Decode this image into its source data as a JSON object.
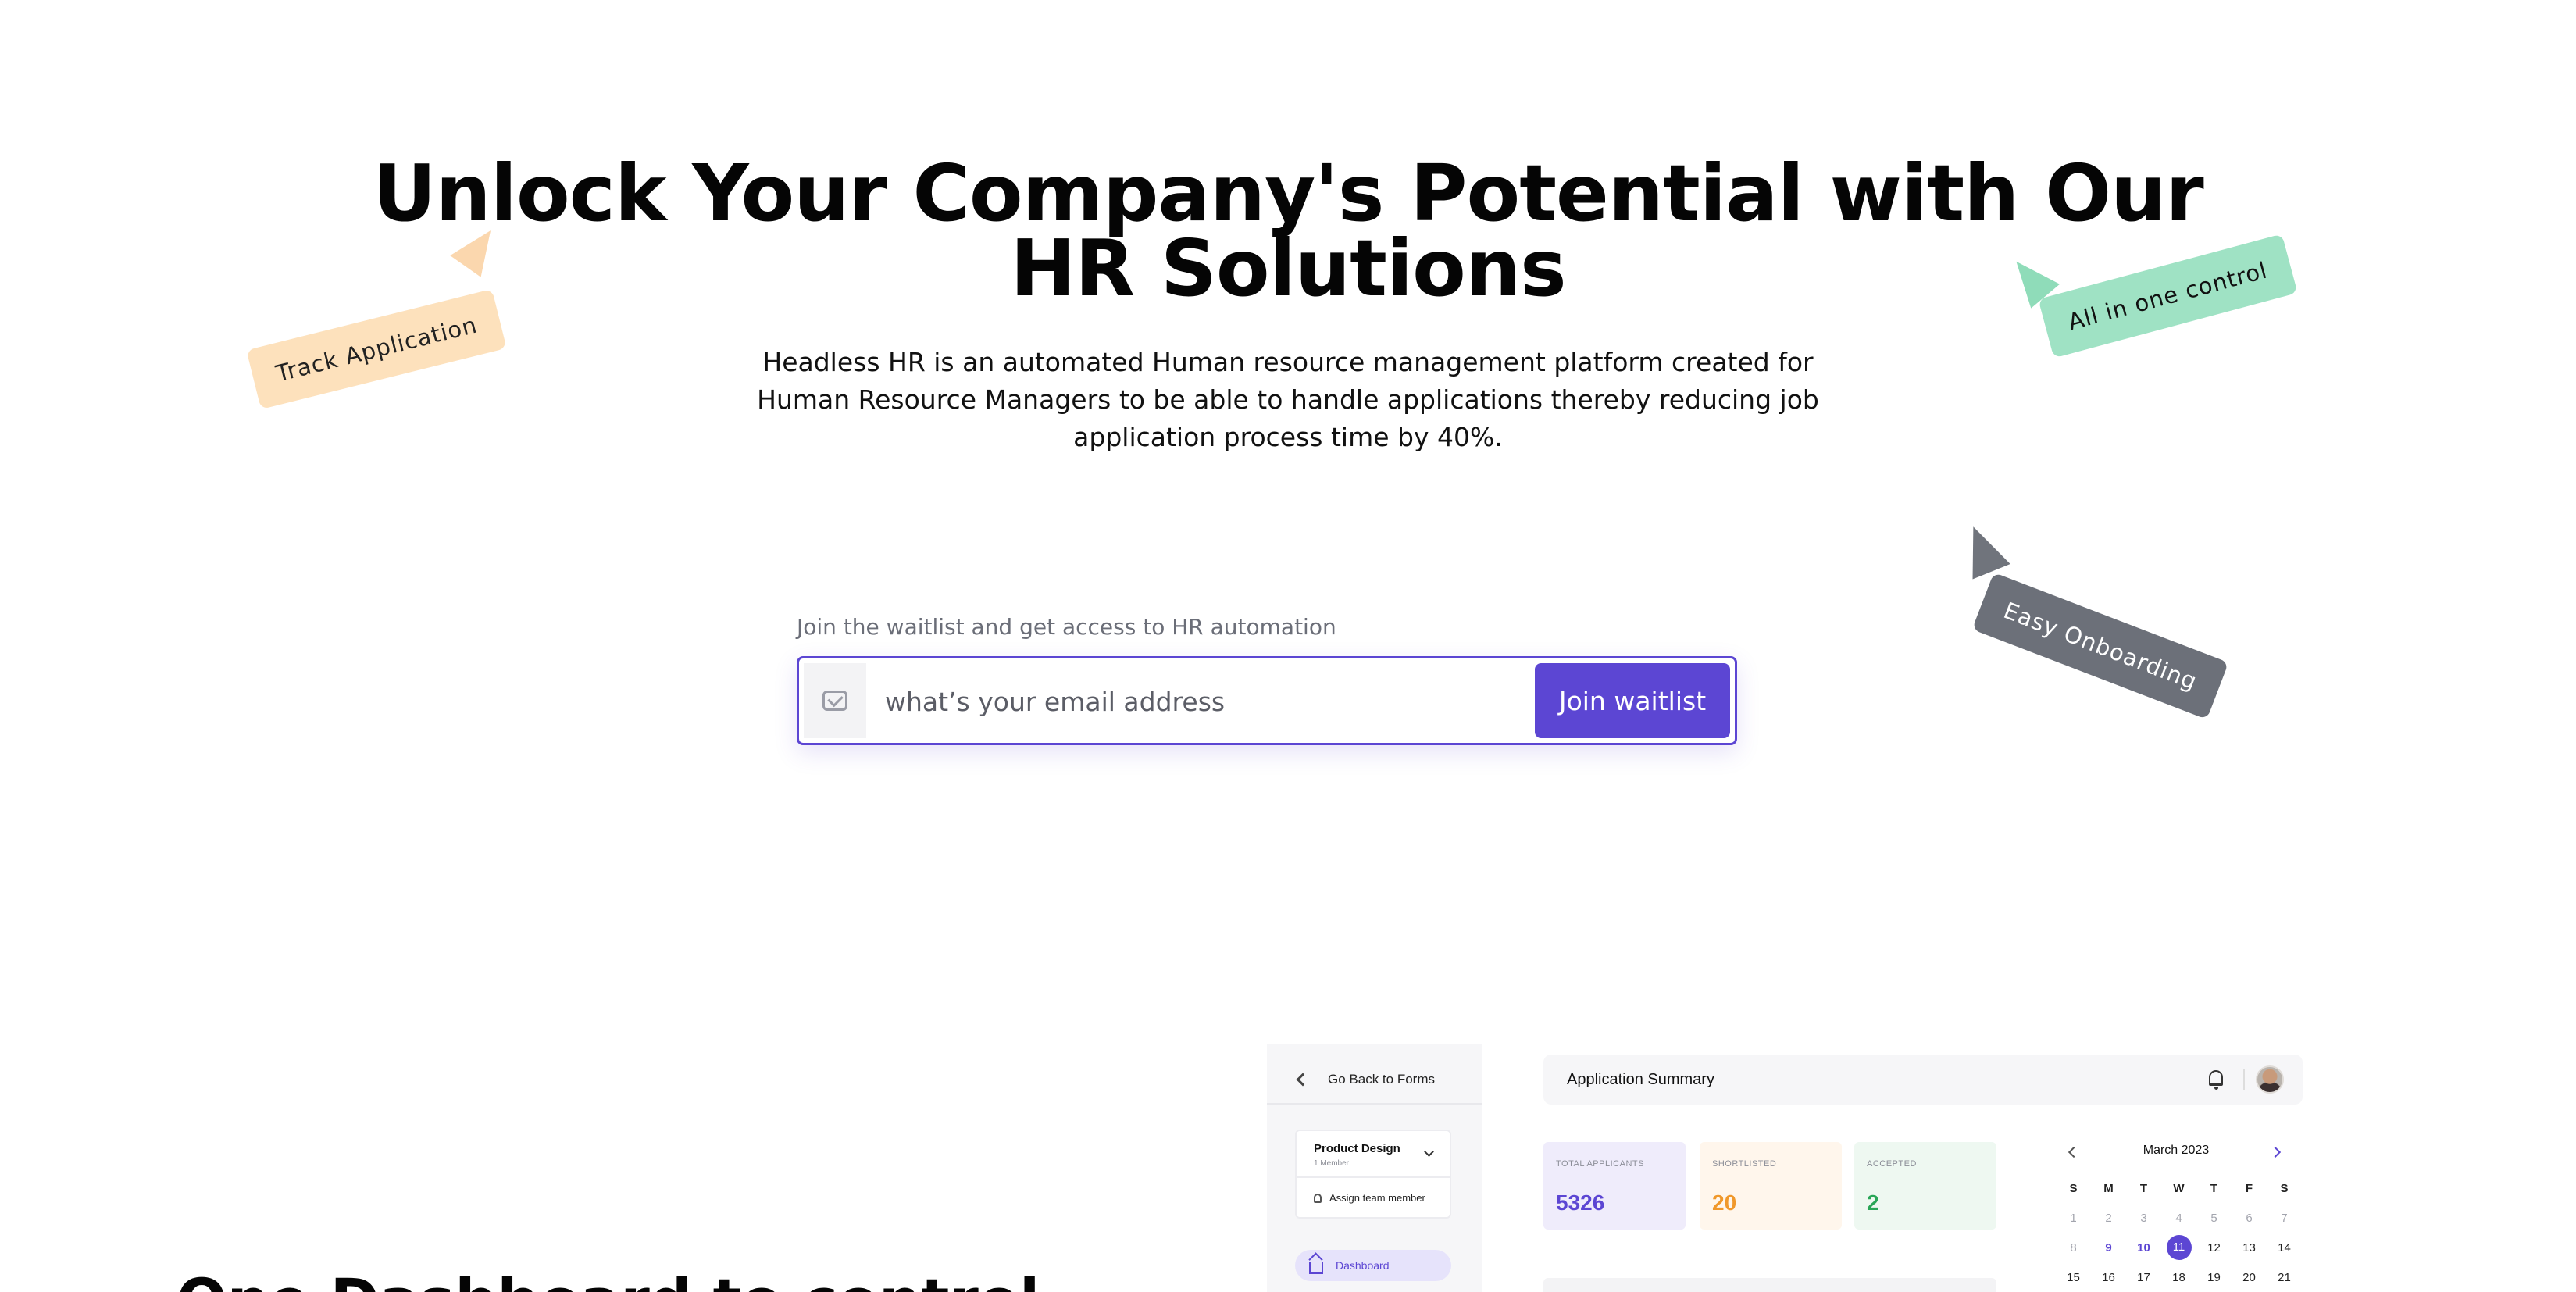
{
  "hero": {
    "title_line1": "Unlock Your Company's Potential with Our",
    "title_line2": "HR Solutions",
    "subtitle": "Headless HR is an automated Human resource management platform created for Human Resource Managers to be able to handle applications thereby reducing job application process time by 40%."
  },
  "tags": {
    "track": "Track Application",
    "control": "All in one control",
    "onboarding": "Easy Onboarding"
  },
  "waitlist": {
    "label": "Join the waitlist and get access to HR automation",
    "email_placeholder": "what’s your email address",
    "email_value": "",
    "button_label": "Join waitlist"
  },
  "section": {
    "heading": "One Dashboard to control"
  },
  "dashboard": {
    "back_label": "Go Back to Forms",
    "team_name": "Product Design",
    "team_members": "1 Member",
    "assign_label": "Assign team member",
    "nav_dashboard": "Dashboard",
    "summary_title": "Application Summary",
    "stats": [
      {
        "label": "TOTAL APPLICANTS",
        "value": "5326"
      },
      {
        "label": "SHORTLISTED",
        "value": "20"
      },
      {
        "label": "ACCEPTED",
        "value": "2"
      }
    ],
    "calendar": {
      "month": "March 2023",
      "weekdays": [
        "S",
        "M",
        "T",
        "W",
        "T",
        "F",
        "S"
      ],
      "week1": [
        "1",
        "2",
        "3",
        "4",
        "5",
        "6",
        "7"
      ],
      "week2": [
        "8",
        "9",
        "10",
        "11",
        "12",
        "13",
        "14"
      ],
      "week3": [
        "15",
        "16",
        "17",
        "18",
        "19",
        "20",
        "21"
      ],
      "selected_day": "11"
    }
  },
  "colors": {
    "accent": "#5c46d3",
    "tag_track": "#fde1bc",
    "tag_control": "#9fe2c4",
    "tag_onboarding": "#6c7079"
  },
  "icons": {
    "email": "mail-icon",
    "back": "chevron-left-icon",
    "dropdown": "chevron-down-icon",
    "assign": "person-icon",
    "dashboard": "home-icon",
    "notification": "bell-icon"
  }
}
